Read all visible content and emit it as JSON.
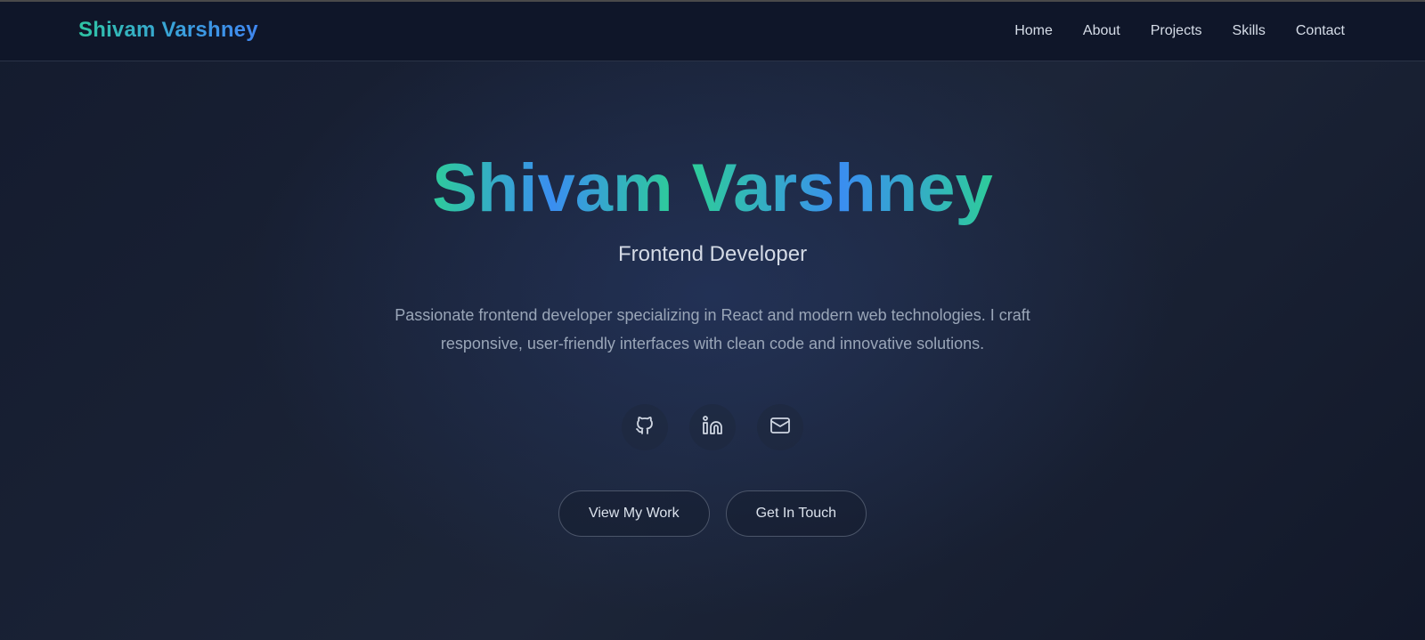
{
  "nav": {
    "brand": "Shivam Varshney",
    "links": [
      "Home",
      "About",
      "Projects",
      "Skills",
      "Contact"
    ]
  },
  "hero": {
    "name_first": "Shivam",
    "name_last": "Varshney",
    "subtitle": "Frontend Developer",
    "description": "Passionate frontend developer specializing in React and modern web technologies. I craft responsive, user-friendly interfaces with clean code and innovative solutions.",
    "socials": [
      {
        "icon": "github-icon"
      },
      {
        "icon": "linkedin-icon"
      },
      {
        "icon": "mail-icon"
      }
    ],
    "buttons": {
      "primary": "View My Work",
      "secondary": "Get In Touch"
    }
  },
  "colors": {
    "background": "#131a2c",
    "navbar": "#0f1629",
    "accent_green": "#2ecc9a",
    "accent_blue": "#3a8ef0"
  }
}
